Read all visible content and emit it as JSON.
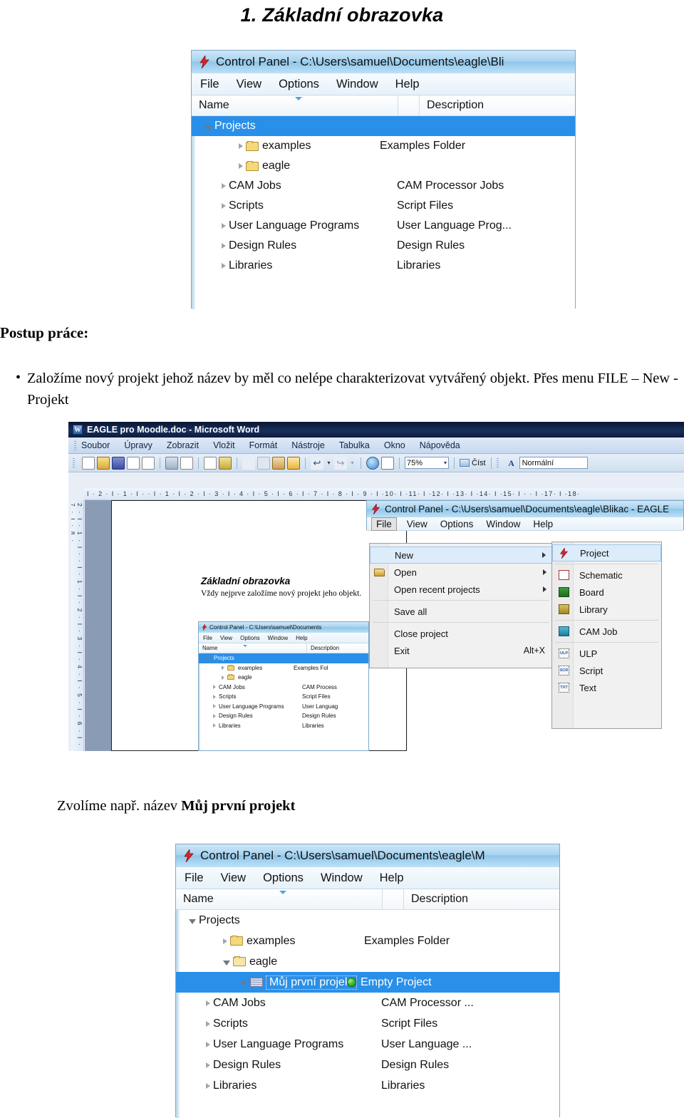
{
  "page": {
    "title": "1. Základní obrazovka",
    "section_label": "Postup práce:",
    "bullet": "Založíme nový projekt jehož název by měl co nelépe charakterizovat vytvářený objekt. Přes menu FILE – New - Projekt",
    "bullet_marker": "•",
    "caption_bottom_prefix": "Zvolíme např. název ",
    "caption_bottom_bold": "Můj první projekt"
  },
  "colors": {
    "selection_blue": "#2a8fe8",
    "eagle_title_blue": "#a8d4f0",
    "word_title_navy": "#16305e",
    "folder_yellow": "#f4d87a",
    "status_green": "#3fbc2e"
  },
  "screenshot1": {
    "title": "Control Panel - C:\\Users\\samuel\\Documents\\eagle\\Bli",
    "app_icon": "eagle-bolt-icon",
    "menu": [
      "File",
      "View",
      "Options",
      "Window",
      "Help"
    ],
    "columns": {
      "name": "Name",
      "description": "Description"
    },
    "tree": [
      {
        "label": "Projects",
        "desc": "",
        "depth": 0,
        "twisty": "open",
        "icon": "none",
        "selected": true
      },
      {
        "label": "examples",
        "desc": "Examples Folder",
        "depth": 2,
        "twisty": "closed",
        "icon": "folder",
        "selected": false
      },
      {
        "label": "eagle",
        "desc": "",
        "depth": 2,
        "twisty": "closed",
        "icon": "folder",
        "selected": false
      },
      {
        "label": "CAM Jobs",
        "desc": "CAM Processor Jobs",
        "depth": 1,
        "twisty": "closed",
        "icon": "none",
        "selected": false
      },
      {
        "label": "Scripts",
        "desc": "Script Files",
        "depth": 1,
        "twisty": "closed",
        "icon": "none",
        "selected": false
      },
      {
        "label": "User Language Programs",
        "desc": "User Language Prog...",
        "depth": 1,
        "twisty": "closed",
        "icon": "none",
        "selected": false
      },
      {
        "label": "Design Rules",
        "desc": "Design Rules",
        "depth": 1,
        "twisty": "closed",
        "icon": "none",
        "selected": false
      },
      {
        "label": "Libraries",
        "desc": "Libraries",
        "depth": 1,
        "twisty": "closed",
        "icon": "none",
        "selected": false
      }
    ]
  },
  "word": {
    "title": "EAGLE pro Moodle.doc - Microsoft Word",
    "app_icon": "word-document-icon",
    "menu": [
      "Soubor",
      "Úpravy",
      "Zobrazit",
      "Vložit",
      "Formát",
      "Nástroje",
      "Tabulka",
      "Okno",
      "Nápověda"
    ],
    "toolbar": {
      "zoom_value": "75%",
      "read_label": "Číst",
      "style_value": "Normální",
      "style_icon": "style-A-icon",
      "icons": [
        "new-document-icon",
        "open-folder-icon",
        "save-icon",
        "email-icon",
        "permission-icon",
        "print-icon",
        "print-preview-icon",
        "spelling-icon",
        "research-icon",
        "cut-icon",
        "copy-icon",
        "paste-icon",
        "format-painter-icon",
        "undo-icon",
        "redo-icon",
        "insert-hyperlink-icon",
        "insert-table-icon"
      ]
    },
    "hruler": "I · 2 · I · 1 · I ·  · I · 1 · I · 2 · I · 3 · I · 4 · I · 5 · I · 6 · I · 7 · I · 8 · I · 9 · I ·10· I ·11· I ·12· I ·13· I ·14· I ·15· I ·    · I ·17· I ·18·",
    "vruler": "2 · I · 1 · I ·  · I · 1 · I · 2 · I · 3 · I · 4 · I · 5 · I · 6 · I · 7 · I · 8 ·",
    "document": {
      "heading": "Základní obrazovka",
      "paragraph": "Vždy nejprve založíme nový projekt jeho objekt.",
      "embedded_shot": {
        "title": "Control Panel - C:\\Users\\samuel\\Documents",
        "menu": [
          "File",
          "View",
          "Options",
          "Window",
          "Help"
        ],
        "columns": {
          "name": "Name",
          "description": "Description"
        },
        "tree": [
          {
            "label": "Projects",
            "desc": "",
            "depth": 0,
            "twisty": "open",
            "icon": "none",
            "selected": true
          },
          {
            "label": "examples",
            "desc": "Examples Fol",
            "depth": 2,
            "twisty": "closed",
            "icon": "folder",
            "selected": false
          },
          {
            "label": "eagle",
            "desc": "",
            "depth": 2,
            "twisty": "closed",
            "icon": "folder",
            "selected": false
          },
          {
            "label": "CAM Jobs",
            "desc": "CAM Process",
            "depth": 1,
            "twisty": "closed",
            "icon": "none",
            "selected": false
          },
          {
            "label": "Scripts",
            "desc": "Script Files",
            "depth": 1,
            "twisty": "closed",
            "icon": "none",
            "selected": false
          },
          {
            "label": "User Language Programs",
            "desc": "User Languag",
            "depth": 1,
            "twisty": "closed",
            "icon": "none",
            "selected": false
          },
          {
            "label": "Design Rules",
            "desc": "Design Rules",
            "depth": 1,
            "twisty": "closed",
            "icon": "none",
            "selected": false
          },
          {
            "label": "Libraries",
            "desc": "Libraries",
            "depth": 1,
            "twisty": "closed",
            "icon": "none",
            "selected": false
          }
        ]
      }
    }
  },
  "screenshot2": {
    "title": "Control Panel - C:\\Users\\samuel\\Documents\\eagle\\Blikac - EAGLE",
    "menu": [
      "File",
      "View",
      "Options",
      "Window",
      "Help"
    ],
    "active_menu": "File",
    "file_menu": [
      {
        "label": "New",
        "arrow": true,
        "shortcut": "",
        "icon": "none",
        "highlighted": true
      },
      {
        "label": "Open",
        "arrow": true,
        "shortcut": "",
        "icon": "open-folder-icon",
        "highlighted": false
      },
      {
        "label": "Open recent projects",
        "arrow": true,
        "shortcut": "",
        "icon": "none",
        "highlighted": false
      },
      {
        "label": "Save all",
        "arrow": false,
        "shortcut": "",
        "icon": "none",
        "highlighted": false
      },
      {
        "label": "Close project",
        "arrow": false,
        "shortcut": "",
        "icon": "none",
        "highlighted": false
      },
      {
        "label": "Exit",
        "arrow": false,
        "shortcut": "Alt+X",
        "icon": "none",
        "highlighted": false
      }
    ],
    "new_submenu": [
      {
        "label": "Project",
        "icon": "eagle-bolt-icon",
        "highlighted": true
      },
      {
        "label": "Schematic",
        "icon": "schematic-icon",
        "highlighted": false
      },
      {
        "label": "Board",
        "icon": "board-icon",
        "highlighted": false
      },
      {
        "label": "Library",
        "icon": "library-icon",
        "highlighted": false
      },
      {
        "label": "CAM Job",
        "icon": "cam-job-icon",
        "highlighted": false
      },
      {
        "label": "ULP",
        "icon": "ulp-icon",
        "highlighted": false
      },
      {
        "label": "Script",
        "icon": "script-icon",
        "highlighted": false
      },
      {
        "label": "Text",
        "icon": "text-icon",
        "highlighted": false
      }
    ]
  },
  "screenshot3": {
    "title": "Control Panel - C:\\Users\\samuel\\Documents\\eagle\\M",
    "menu": [
      "File",
      "View",
      "Options",
      "Window",
      "Help"
    ],
    "columns": {
      "name": "Name",
      "description": "Description"
    },
    "tree": [
      {
        "label": "Projects",
        "desc": "",
        "depth": 0,
        "twisty": "open",
        "icon": "none",
        "selected": false
      },
      {
        "label": "examples",
        "desc": "Examples Folder",
        "depth": 2,
        "twisty": "closed",
        "icon": "folder",
        "selected": false
      },
      {
        "label": "eagle",
        "desc": "",
        "depth": 2,
        "twisty": "open",
        "icon": "folder-open",
        "selected": false
      },
      {
        "label": "Můj první projekt",
        "desc": "Empty Project",
        "depth": 3,
        "twisty": "open",
        "icon": "project",
        "selected": true,
        "status": "green"
      },
      {
        "label": "CAM Jobs",
        "desc": "CAM Processor ...",
        "depth": 1,
        "twisty": "closed",
        "icon": "none",
        "selected": false
      },
      {
        "label": "Scripts",
        "desc": "Script Files",
        "depth": 1,
        "twisty": "closed",
        "icon": "none",
        "selected": false
      },
      {
        "label": "User Language Programs",
        "desc": "User Language ...",
        "depth": 1,
        "twisty": "closed",
        "icon": "none",
        "selected": false
      },
      {
        "label": "Design Rules",
        "desc": "Design Rules",
        "depth": 1,
        "twisty": "closed",
        "icon": "none",
        "selected": false
      },
      {
        "label": "Libraries",
        "desc": "Libraries",
        "depth": 1,
        "twisty": "closed",
        "icon": "none",
        "selected": false
      }
    ]
  }
}
